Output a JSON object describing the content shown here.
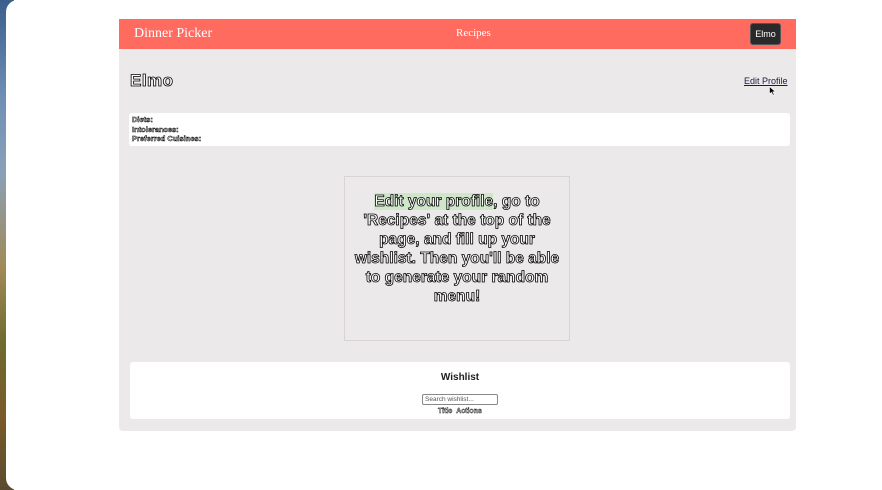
{
  "navbar": {
    "brand": "Dinner Picker",
    "recipes_link": "Recipes",
    "user_button": "Elmo",
    "color": "#ff6b5f"
  },
  "profile": {
    "name": "Elmo",
    "edit_link": "Edit Profile",
    "diets_label": "Diets:",
    "intolerances_label": "Intolerances:",
    "preferred_cuisines_label": "Preferred Cuisines:"
  },
  "prompt": {
    "highlighted": "Edit your profile",
    "rest": ", go to 'Recipes' at the top of the page, and fill up your wishlist. Then you'll be able to generate your random menu!"
  },
  "wishlist": {
    "title": "Wishlist",
    "search_placeholder": "Search wishlist...",
    "columns": [
      "Title",
      "Actions"
    ]
  },
  "icons": {
    "cursor": "mouse-pointer-icon"
  }
}
